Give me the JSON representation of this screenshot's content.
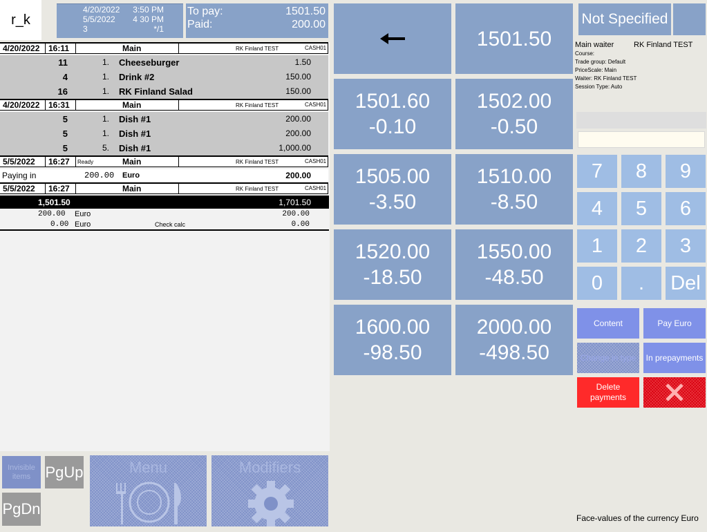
{
  "header": {
    "logo": "r_k",
    "date1": "4/20/2022",
    "time1": "3:50 PM",
    "date2": "5/5/2022",
    "time2": "4 30 PM",
    "guests": "3",
    "table": "*/1",
    "to_pay_label": "To pay:",
    "to_pay_value": "1501.50",
    "paid_label": "Paid:",
    "paid_value": "200.00"
  },
  "check": {
    "sessions": [
      {
        "date": "4/20/2022",
        "time": "16:11",
        "status": "",
        "menu": "Main",
        "waiter": "RK Finland TEST",
        "cash": "CASH01",
        "items": [
          {
            "code": "11",
            "qty": "1.",
            "name": "Cheeseburger",
            "price": "1.50"
          },
          {
            "code": "4",
            "qty": "1.",
            "name": "Drink #2",
            "price": "150.00"
          },
          {
            "code": "16",
            "qty": "1.",
            "name": "RK Finland Salad",
            "price": "150.00"
          }
        ]
      },
      {
        "date": "4/20/2022",
        "time": "16:31",
        "status": "",
        "menu": "Main",
        "waiter": "RK Finland TEST",
        "cash": "CASH01",
        "items": [
          {
            "code": "5",
            "qty": "1.",
            "name": "Dish #1",
            "price": "200.00"
          },
          {
            "code": "5",
            "qty": "1.",
            "name": "Dish #1",
            "price": "200.00"
          },
          {
            "code": "5",
            "qty": "5.",
            "name": "Dish #1",
            "price": "1,000.00"
          }
        ]
      },
      {
        "date": "5/5/2022",
        "time": "16:27",
        "status": "Ready",
        "menu": "Main",
        "waiter": "RK Finland TEST",
        "cash": "CASH01",
        "items": []
      },
      {
        "date": "5/5/2022",
        "time": "16:27",
        "status": "",
        "menu": "Main",
        "waiter": "RK Finland TEST",
        "cash": "CASH01",
        "items": []
      }
    ],
    "paying_in": {
      "label": "Paying in",
      "amount": "200.00",
      "currency": "Euro",
      "total": "200.00"
    },
    "total_left": "1,501.50",
    "total_right": "1,701.50",
    "sum1": {
      "amount": "200.00",
      "currency": "Euro",
      "note": "",
      "right": "200.00"
    },
    "sum2": {
      "amount": "0.00",
      "currency": "Euro",
      "note": "Check calc",
      "right": "0.00"
    }
  },
  "bottom_buttons": {
    "invisible_items": "Invisible items",
    "pgup": "PgUp",
    "pgdn": "PgDn",
    "menu": "Menu",
    "modifiers": "Modifiers"
  },
  "amounts": {
    "back_icon": "left-arrow-icon",
    "exact": "1501.50",
    "options": [
      {
        "amount": "1501.60",
        "change": "-0.10"
      },
      {
        "amount": "1502.00",
        "change": "-0.50"
      },
      {
        "amount": "1505.00",
        "change": "-3.50"
      },
      {
        "amount": "1510.00",
        "change": "-8.50"
      },
      {
        "amount": "1520.00",
        "change": "-18.50"
      },
      {
        "amount": "1550.00",
        "change": "-48.50"
      },
      {
        "amount": "1600.00",
        "change": "-98.50"
      },
      {
        "amount": "2000.00",
        "change": "-498.50"
      }
    ]
  },
  "right_panel": {
    "customer": "Not Specified",
    "main_waiter_label": "Main waiter",
    "main_waiter_value": "RK Finland TEST",
    "course": "Course:",
    "trade_group": "Trade group: Default",
    "price_scale": "PriceScale: Main",
    "waiter": "Waiter: RK Finland TEST",
    "session_type": "Session Type: Auto",
    "input_value": "",
    "keys": [
      "7",
      "8",
      "9",
      "4",
      "5",
      "6",
      "1",
      "2",
      "3",
      "0",
      ".",
      "Del"
    ],
    "content": "Content",
    "pay_euro": "Pay Euro",
    "change_in_type": "Change in type",
    "in_prepayments": "In prepayments",
    "delete_payments": "Delete payments",
    "footer": "Face-values of the currency Euro"
  },
  "colors": {
    "tile_blue": "#88a2c8",
    "key_blue": "#9fbde4",
    "action_blue": "#7f91e8",
    "delete_red": "#ff2a2a",
    "cancel_red": "#d8000f"
  }
}
